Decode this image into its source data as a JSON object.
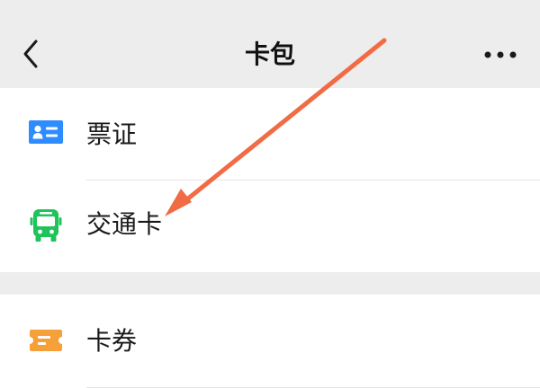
{
  "nav": {
    "title": "卡包",
    "back_icon": "chevron-left-icon",
    "more_icon": "more-horizontal-icon"
  },
  "groups": [
    {
      "items": [
        {
          "label": "票证",
          "icon": "id-card-icon",
          "icon_color": "#2f8cff"
        },
        {
          "label": "交通卡",
          "icon": "bus-icon",
          "icon_color": "#1ec45a"
        }
      ]
    },
    {
      "items": [
        {
          "label": "卡券",
          "icon": "coupon-ticket-icon",
          "icon_color": "#f5a038"
        }
      ]
    }
  ],
  "annotation": {
    "arrow_color": "#f16b45",
    "points_to": "交通卡"
  }
}
